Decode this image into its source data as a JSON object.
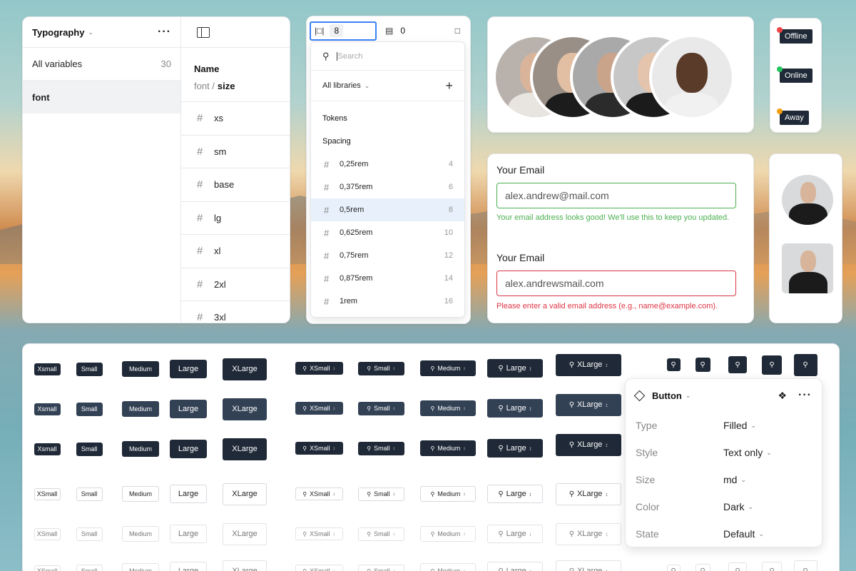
{
  "variables": {
    "collection_title": "Typography",
    "all_variables_label": "All variables",
    "all_variables_count": "30",
    "group_font": "font",
    "column_header": "Name",
    "path_prefix": "font /",
    "path_group": "size",
    "tokens": [
      "xs",
      "sm",
      "base",
      "lg",
      "xl",
      "2xl",
      "3xl"
    ]
  },
  "spacing": {
    "gap_value": "8",
    "padding_value": "0",
    "search_placeholder": "Search",
    "library_filter": "All libraries",
    "section_tokens": "Tokens",
    "section_spacing": "Spacing",
    "items": [
      {
        "name": "0,25rem",
        "value": "4"
      },
      {
        "name": "0,375rem",
        "value": "6"
      },
      {
        "name": "0,5rem",
        "value": "8",
        "selected": true
      },
      {
        "name": "0,625rem",
        "value": "10"
      },
      {
        "name": "0,75rem",
        "value": "12"
      },
      {
        "name": "0,875rem",
        "value": "14"
      },
      {
        "name": "1rem",
        "value": "16"
      }
    ]
  },
  "status": {
    "offline": "Offline",
    "online": "Online",
    "away": "Away",
    "colors": {
      "offline": "#ef4444",
      "online": "#22c55e",
      "away": "#f59e0b"
    }
  },
  "email": {
    "label1": "Your Email",
    "value1": "alex.andrew@mail.com",
    "success_msg": "Your email address looks good! We'll use this to keep you updated.",
    "label2": "Your Email",
    "value2": "alex.andrewsmail.com",
    "error_msg": "Please enter a valid email address (e.g., name@example.com).",
    "colors": {
      "success": "#4caf50",
      "error": "#dc3545"
    }
  },
  "buttons": {
    "size_labels": [
      "Xsmall",
      "Small",
      "Medium",
      "Large",
      "XLarge"
    ],
    "size_labels_alt": [
      "XSmall",
      "Small",
      "Medium",
      "Large",
      "XLarge"
    ],
    "dropdown_labels": [
      "XSmall",
      "Small",
      "Medium",
      "Large",
      "XLarge"
    ]
  },
  "props": {
    "component_name": "Button",
    "rows": [
      {
        "key": "Type",
        "value": "Filled"
      },
      {
        "key": "Style",
        "value": "Text only"
      },
      {
        "key": "Size",
        "value": "md"
      },
      {
        "key": "Color",
        "value": "Dark"
      },
      {
        "key": "State",
        "value": "Default"
      }
    ]
  }
}
